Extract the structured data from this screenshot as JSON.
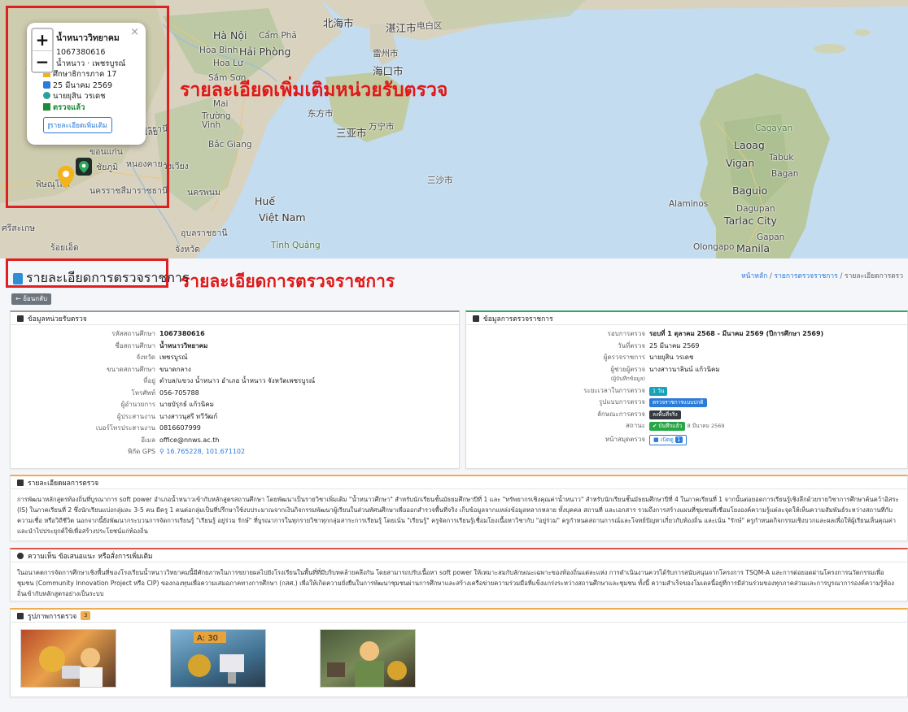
{
  "map": {
    "labels": {
      "hanoi": "Hà Nội",
      "campha": "Cẩm Phả",
      "hoabinh": "Hòa Bình",
      "haiphong": "Hải Phòng",
      "hoalu": "Hoa Lư",
      "samson": "Sầm Sơn",
      "mai": "Mai",
      "truong": "Trường",
      "vinh": "Vinh",
      "bacgiang": "Bắc Giang",
      "hue": "Huế",
      "vietnam": "Việt Nam",
      "tinhquang": "Tỉnh Quảng",
      "beihai": "北海市",
      "zhanjiang": "湛江市",
      "dianbai": "电白区",
      "leizhou": "雷州市",
      "haikou": "海口市",
      "dongfang": "东方市",
      "sanya": "三亚市",
      "wanning": "万宁市",
      "sansha": "三沙市",
      "laoag": "Laoag",
      "tabuk": "Tabuk",
      "vigan": "Vigan",
      "bagan": "Bagan",
      "baguio": "Baguio",
      "alaminos": "Alaminos",
      "dagupan": "Dagupan",
      "tarlac": "Tarlac City",
      "gapan": "Gapan",
      "olongapo": "Olongapo",
      "manila": "Manila",
      "cagayan": "Cagayan",
      "thai1": "อุดรธานี",
      "thai2": "ขอนแก่น",
      "thai3": "พิษณุโลก",
      "thai4": "นครราชสีมา",
      "thai5": "อุบลราชธานี",
      "thai6": "ศรีสะเกษ",
      "thai7": "หนองคาย",
      "thai8": "นครพนม",
      "thai9": "ร้อยเอ็ด",
      "thai10": "ราชธานี",
      "thai11": "วังเวียง",
      "thai12": "จังหวัด",
      "thai13": "ชัยภูมิ",
      "thai14": "เลย"
    },
    "popup": {
      "title": "น้ำหนาววิทยาคม",
      "code": "1067380616",
      "location": "น้ำหนาว · เพชรบูรณ์",
      "region": "ศึกษาธิการภาค 17",
      "date": "25 มีนาคม 2569",
      "inspector": "นายยุสิน วรเดช",
      "status": "ตรวจแล้ว",
      "more_button": "รายละเอียดเพิ่มเติม",
      "close": "×"
    },
    "zoom_in": "+",
    "zoom_out": "−"
  },
  "annotations": {
    "map_label": "รายละเอียดเพิ่มเติมหน่วยรับตรวจ",
    "title_label": "รายละเอียดการตรวจราชการ"
  },
  "page": {
    "title": "รายละเอียดการตรวจราชการ",
    "breadcrumb": [
      "หน้าหลัก",
      "/",
      "รายการตรวจราชการ",
      "/",
      "รายละเอียดการตรว"
    ],
    "back_button": "← ย้อนกลับ"
  },
  "unit_card": {
    "title": "ข้อมูลหน่วยรับตรวจ",
    "rows": [
      {
        "k": "รหัสสถานศึกษา",
        "v": "1067380616",
        "style": "bold"
      },
      {
        "k": "ชื่อสถานศึกษา",
        "v": "น้ำหนาววิทยาคม",
        "style": "bold"
      },
      {
        "k": "จังหวัด",
        "v": "เพชรบูรณ์",
        "style": ""
      },
      {
        "k": "ขนาดสถานศึกษา",
        "v": "ขนาดกลาง",
        "style": ""
      },
      {
        "k": "ที่อยู่",
        "v": "ตำบล/แขวง น้ำหนาว อำเภอ น้ำหนาว จังหวัดเพชรบูรณ์",
        "style": ""
      },
      {
        "k": "โทรศัพท์",
        "v": "056-705788",
        "style": ""
      },
      {
        "k": "ผู้อำนวยการ",
        "v": "นายบัรุกธ์ แก้วนิคม",
        "style": ""
      },
      {
        "k": "ผู้ประสานงาน",
        "v": "นางสาวนุสรี ทวีวัฒก์",
        "style": ""
      },
      {
        "k": "เบอร์โทรประสานงาน",
        "v": "0816607999",
        "style": ""
      },
      {
        "k": "อีเมล",
        "v": "office@nnws.ac.th",
        "style": ""
      },
      {
        "k": "พิกัด GPS",
        "v": "16.765228, 101.671102",
        "style": "link"
      }
    ]
  },
  "inspect_card": {
    "title": "ข้อมูลการตรวจราชการ",
    "rows": [
      {
        "k": "รอบการตรวจ",
        "v": "รอบที่ 1 ตุลาคม 2568 - มีนาคม 2569 (ปีการศึกษา 2569)",
        "style": "bold"
      },
      {
        "k": "วันที่ตรวจ",
        "v": "25 มีนาคม 2569",
        "style": ""
      },
      {
        "k": "ผู้ตรวจราชการ",
        "v": "นายยุสิน วรเดช",
        "style": ""
      },
      {
        "k": "ผู้ช่วยผู้ตรวจ",
        "v": "นางสาวนาลินน์ แก้วนิคม",
        "style": ""
      }
    ],
    "assistant_note": "(ผู้บันทึกข้อมูล)",
    "duration_label": "ระยะเวลาในการตรวจ",
    "duration_badge": "1 วัน",
    "format_label": "รูปแบบการตรวจ",
    "format_badge": "ตรวจราชการแบบปกติ",
    "nature_label": "ลักษณะการตรวจ",
    "nature_badge": "ลงพื้นที่จริง",
    "status_label": "สถานะ",
    "status_badge": "✔ บันทึกแล้ว",
    "status_date": "8 มีนาคม 2569",
    "book_label": "หน้าสมุดตรวจ",
    "book_button": "เปิดดู",
    "book_count": "1"
  },
  "result_card": {
    "title": "รายละเอียดผลการตรวจ",
    "text": "การพัฒนาหลักสูตรท้องถิ่นที่บูรณาการ soft power อำเภอน้ำหนาวเข้ากับหลักสูตรสถานศึกษา โดยพัฒนาเป็นรายวิชาเพิ่มเติม \"น้ำหนาวศึกษา\" สำหรับนักเรียนชั้นมัธยมศึกษาปีที่ 1 และ \"ทรัพยากรเชิงคุณค่าน้ำหนาว\" สำหรับนักเรียนชั้นมัธยมศึกษาปีที่ 4 ในภาคเรียนที่ 1 จากนั้นต่อยอดการเรียนรู้เชิงลึกด้วยรายวิชาการศึกษาค้นคว้าอิสระ (IS) ในภาคเรียนที่ 2 ซึ่งนักเรียนแบ่งกลุ่มละ 3-5 คน มีครู 1 คนต่อกลุ่มเป็นที่ปรึกษาใช้งบประมาณจากเงินกิจกรรมพัฒนาผู้เรียนในส่วนทัศนศึกษาเพื่อออกสำรวจพื้นที่จริง เก็บข้อมูลจากแหล่งข้อมูลหลากหลาย ทั้งบุคคล สถานที่ และเอกสาร รวมถึงการสร้างแผนที่ชุมชนที่เชื่อมโยงองค์ความรู้แต่ละจุดให้เห็นความสัมพันธ์ระหว่างสถานที่กับความเชื่อ หรือวิถีชีวิต นอกจากนี้ยังพัฒนากระบวนการจัดการเรียนรู้ \"เรียนรู้ อยู่ร่วม รักษ์\" ที่บูรณาการในทุกรายวิชาทุกกลุ่มสาระการเรียนรู้ โดยเน้น \"เรียนรู้\" ครูจัดการเรียนรู้เชื่อมโยงเนื้อหาวิชากับ \"อยู่ร่วม\" ครูกำหนดสถานการณ์และโจทย์ปัญหาเกี่ยวกับท้องถิ่น และเน้น \"รักษ์\" ครูกำหนดกิจกรรมเชิงบวกและผลเพื่อให้ผู้เรียนเห็นคุณค่าและนำไปประยุกต์ใช้เพื่อสร้างประโยชน์แก่ท้องถิ่น"
  },
  "comment_card": {
    "title": "ความเห็น ข้อเสนอแนะ หรือสั่งการเพิ่มเติม",
    "text": "ในอนาคตการจัดการศึกษาเชิงพื้นที่ของโรงเรียนน้ำหนาววิทยาคมนี้มีศักยภาพในการขยายผลไปยังโรงเรียนในพื้นที่ที่มีบริบทคล้ายคลึงกัน โดยสามารถปรับเนื้อหา soft power ให้เหมาะสมกับลักษณะเฉพาะของท้องถิ่นแต่ละแห่ง การดำเนินงานควรได้รับการสนับสนุนจากโครงการ TSQM-A และการต่อยอดผ่านโครงการนวัตกรรมเพื่อชุมชน (Community Innovation Project หรือ CIP) ของกองทุนเพื่อความเสมอภาคทางการศึกษา (กสศ.) เพื่อให้เกิดความยั่งยืนในการพัฒนาชุมชนผ่านการศึกษาและสร้างเครือข่ายความร่วมมือที่แข็งแกร่งระหว่างสถานศึกษาและชุมชน ทั้งนี้ ความสำเร็จของโมเดลนี้อยู่ที่การมีส่วนร่วมของทุกภาคส่วนและการบูรณาการองค์ความรู้ท้องถิ่นเข้ากับหลักสูตรอย่างเป็นระบบ"
  },
  "photos_card": {
    "title": "รูปภาพการตรวจ",
    "count": "3",
    "photo_text": "A: 30"
  },
  "colors": {
    "accent": "#2b7bd8",
    "annotation_red": "#e01818",
    "success": "#1e8a3a",
    "warning_bar": "#f0ad4e",
    "danger_bar": "#d9534f"
  }
}
